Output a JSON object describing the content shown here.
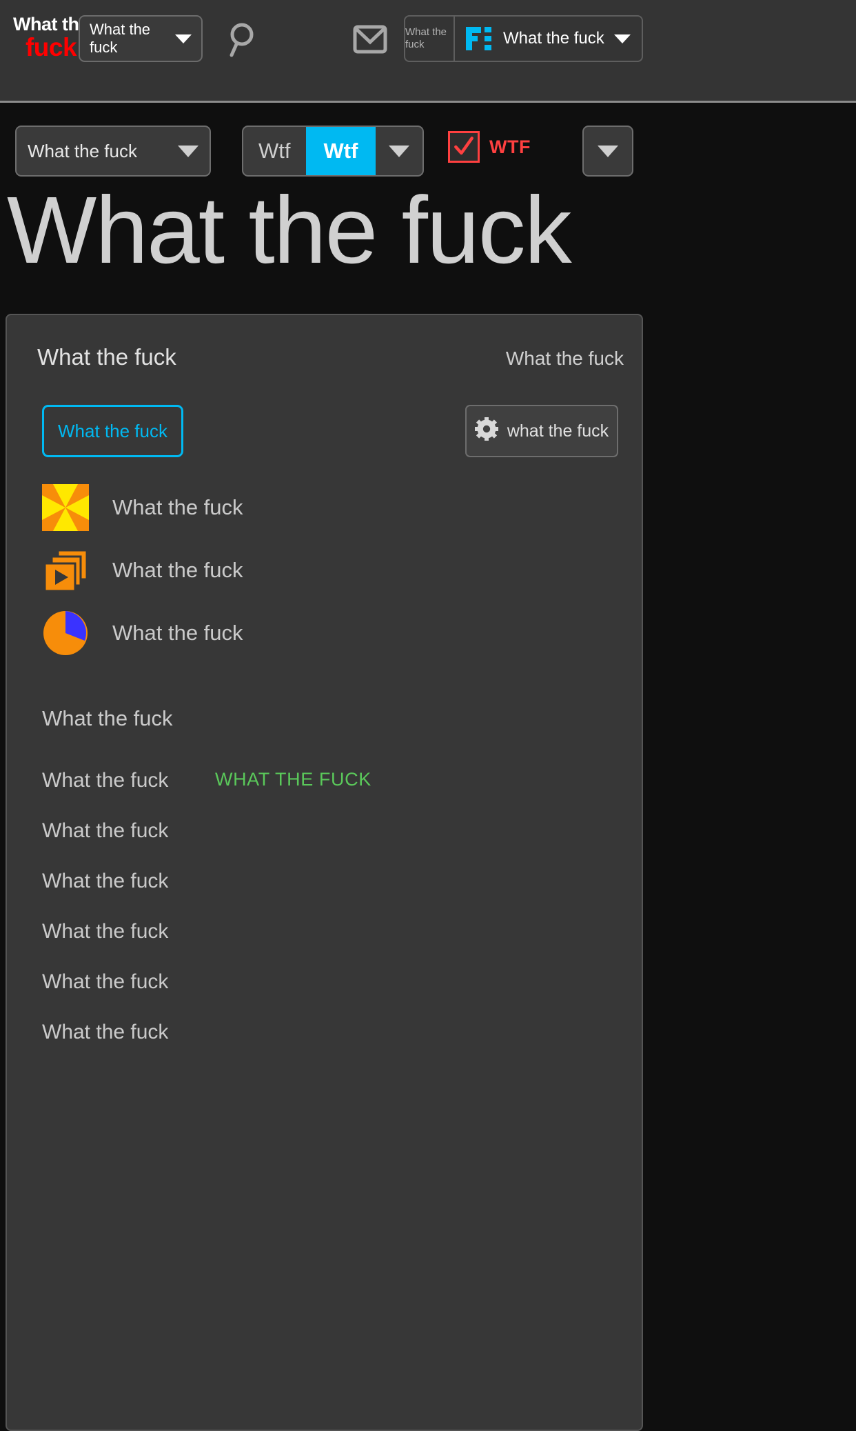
{
  "topbar": {
    "logo": {
      "line1": "What the",
      "line2": "fuck"
    },
    "combo_label": "What the fuck",
    "search_icon": "search-icon",
    "mail_icon": "mail-icon",
    "account_mini": "What the fuck",
    "brand_logo": "fi-logo",
    "account_label": "What the fuck"
  },
  "toolbar": {
    "combo_label": "What the fuck",
    "segments": [
      {
        "label": "Wtf",
        "active": false
      },
      {
        "label": "Wtf",
        "active": true
      }
    ],
    "checkbox": {
      "checked": true,
      "label": "WTF",
      "color": "#ff4040"
    },
    "overflow_icon": "chevron-down-icon"
  },
  "page_title": "What the fuck",
  "card": {
    "title": "What the fuck",
    "meta": "What the fuck",
    "cta_label": "What the fuck",
    "settings_label": "what the fuck",
    "items": [
      {
        "icon": "pinwheel-icon",
        "label": "What the fuck"
      },
      {
        "icon": "slide-stack-icon",
        "label": "What the fuck"
      },
      {
        "icon": "pie-chart-icon",
        "label": "What the fuck"
      }
    ],
    "section_title": "What the fuck",
    "list": [
      "What the fuck",
      "What the fuck",
      "What the fuck",
      "What the fuck",
      "What the fuck",
      "What the fuck"
    ],
    "status_text": "WHAT THE FUCK",
    "status_color": "#5ac85a"
  },
  "colors": {
    "accent": "#00b9f2",
    "alert": "#ff4040",
    "brand_red": "#ff0000",
    "icon_orange": "#f78d0a",
    "icon_yellow": "#ffe800",
    "icon_blue": "#3a33ff",
    "success": "#5ac85a"
  }
}
